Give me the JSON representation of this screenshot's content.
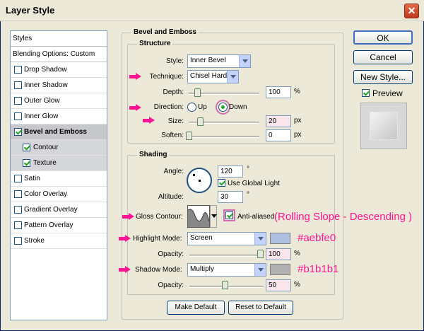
{
  "window": {
    "title": "Layer Style",
    "close_glyph": "✕"
  },
  "styles_list": {
    "header": "Styles",
    "blending_options": "Blending Options: Custom",
    "items": [
      {
        "label": "Drop Shadow",
        "checked": false
      },
      {
        "label": "Inner Shadow",
        "checked": false
      },
      {
        "label": "Outer Glow",
        "checked": false
      },
      {
        "label": "Inner Glow",
        "checked": false
      },
      {
        "label": "Bevel and Emboss",
        "checked": true
      },
      {
        "label": "Contour",
        "checked": true
      },
      {
        "label": "Texture",
        "checked": true
      },
      {
        "label": "Satin",
        "checked": false
      },
      {
        "label": "Color Overlay",
        "checked": false
      },
      {
        "label": "Gradient Overlay",
        "checked": false
      },
      {
        "label": "Pattern Overlay",
        "checked": false
      },
      {
        "label": "Stroke",
        "checked": false
      }
    ]
  },
  "bevel": {
    "title": "Bevel and Emboss",
    "structure": {
      "title": "Structure",
      "style_label": "Style:",
      "style_value": "Inner Bevel",
      "technique_label": "Technique:",
      "technique_value": "Chisel Hard",
      "depth_label": "Depth:",
      "depth_value": "100",
      "depth_unit": "%",
      "direction_label": "Direction:",
      "direction_up": "Up",
      "direction_down": "Down",
      "size_label": "Size:",
      "size_value": "20",
      "size_unit": "px",
      "soften_label": "Soften:",
      "soften_value": "0",
      "soften_unit": "px"
    },
    "shading": {
      "title": "Shading",
      "angle_label": "Angle:",
      "angle_value": "120",
      "angle_unit": "°",
      "use_global_light": "Use Global Light",
      "altitude_label": "Altitude:",
      "altitude_value": "30",
      "altitude_unit": "°",
      "gloss_contour_label": "Gloss Contour:",
      "anti_aliased": "Anti-aliased",
      "highlight_mode_label": "Highlight Mode:",
      "highlight_mode_value": "Screen",
      "highlight_opacity_label": "Opacity:",
      "highlight_opacity_value": "100",
      "highlight_opacity_unit": "%",
      "shadow_mode_label": "Shadow Mode:",
      "shadow_mode_value": "Multiply",
      "shadow_opacity_label": "Opacity:",
      "shadow_opacity_value": "50",
      "shadow_opacity_unit": "%",
      "highlight_color": "#aebfe0",
      "shadow_color": "#b1b1b1"
    },
    "make_default": "Make Default",
    "reset_default": "Reset to Default"
  },
  "annotations": {
    "contour_note": "(Rolling Slope - Descending )",
    "highlight_hex": "#aebfe0",
    "shadow_hex": "#b1b1b1",
    "color": "#ff1493"
  },
  "buttons": {
    "ok": "OK",
    "cancel": "Cancel",
    "new_style": "New Style...",
    "preview": "Preview"
  }
}
